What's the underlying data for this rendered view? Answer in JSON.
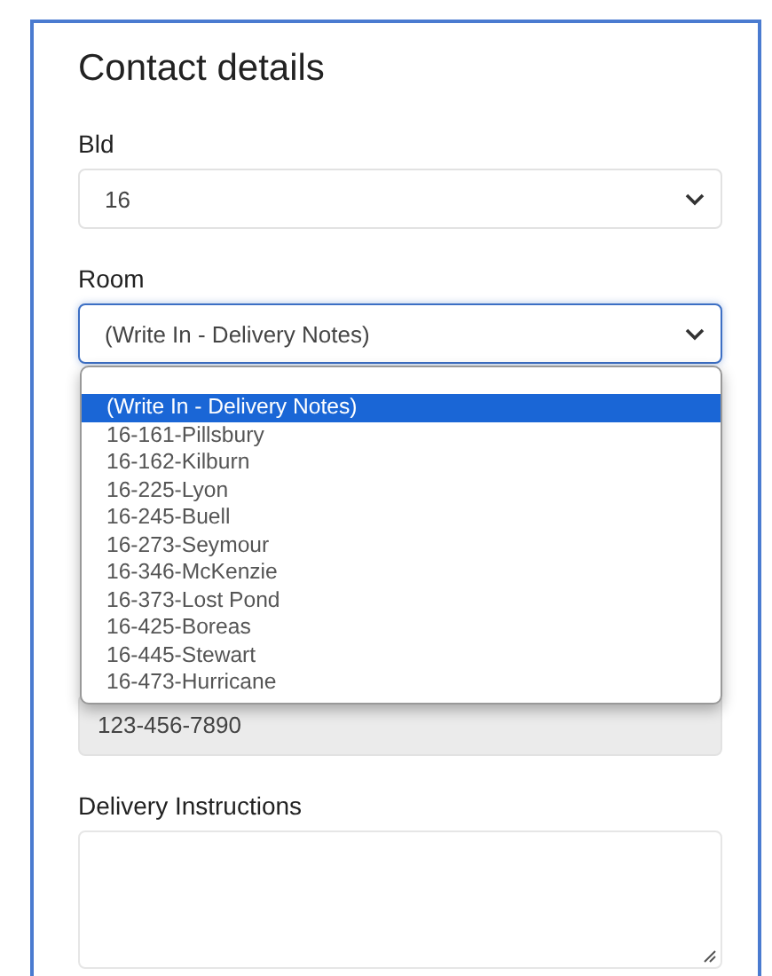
{
  "title": "Contact details",
  "bld": {
    "label": "Bld",
    "value": "16"
  },
  "room": {
    "label": "Room",
    "value": "(Write In - Delivery Notes)",
    "expanded": true,
    "options": [
      {
        "label": "(Write In - Delivery Notes)",
        "selected": true
      },
      {
        "label": "16-161-Pillsbury",
        "selected": false
      },
      {
        "label": "16-162-Kilburn",
        "selected": false
      },
      {
        "label": "16-225-Lyon",
        "selected": false
      },
      {
        "label": "16-245-Buell",
        "selected": false
      },
      {
        "label": "16-273-Seymour",
        "selected": false
      },
      {
        "label": "16-346-McKenzie",
        "selected": false
      },
      {
        "label": "16-373-Lost Pond",
        "selected": false
      },
      {
        "label": "16-425-Boreas",
        "selected": false
      },
      {
        "label": "16-445-Stewart",
        "selected": false
      },
      {
        "label": "16-473-Hurricane",
        "selected": false
      }
    ]
  },
  "phone": {
    "value": "123-456-7890",
    "disabled": true
  },
  "delivery": {
    "label": "Delivery Instructions"
  }
}
